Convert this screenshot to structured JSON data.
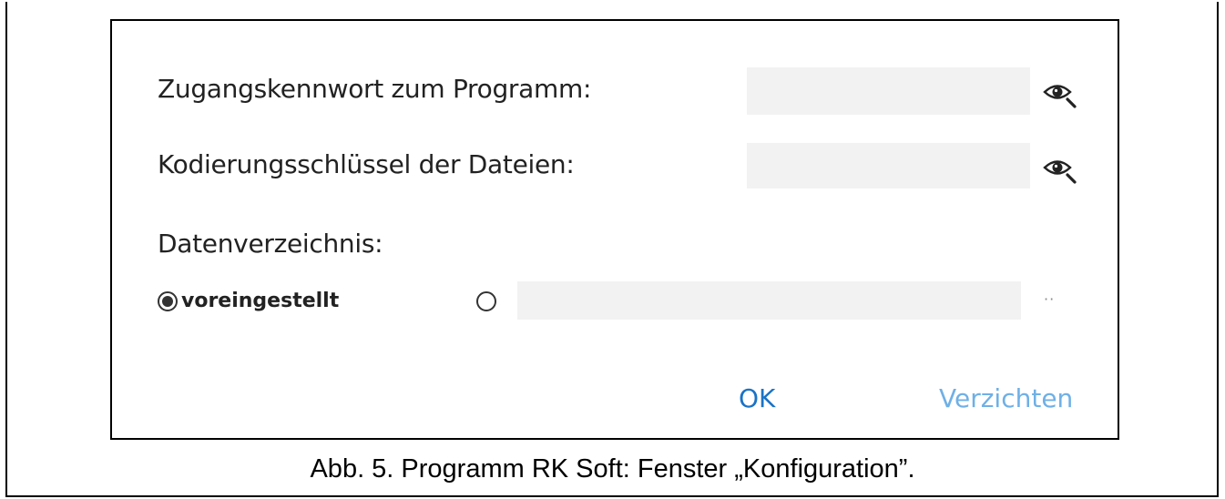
{
  "dialog": {
    "password_label": "Zugangskennwort zum Programm:",
    "password_value": "",
    "encryption_label": "Kodierungsschlüssel der Dateien:",
    "encryption_value": "",
    "data_dir_label": "Datenverzeichnis:",
    "radio_default_label": "voreingestellt",
    "radio_default_selected": true,
    "custom_path_value": "",
    "browse_label": "··",
    "ok_label": "OK",
    "cancel_label": "Verzichten"
  },
  "colors": {
    "ok": "#1a73c6",
    "cancel": "#6fb0e6",
    "field_bg": "#f2f2f2"
  },
  "icons": {
    "reveal": "eye-magnifier-icon"
  },
  "caption": "Abb. 5. Programm RK Soft: Fenster „Konfiguration”."
}
